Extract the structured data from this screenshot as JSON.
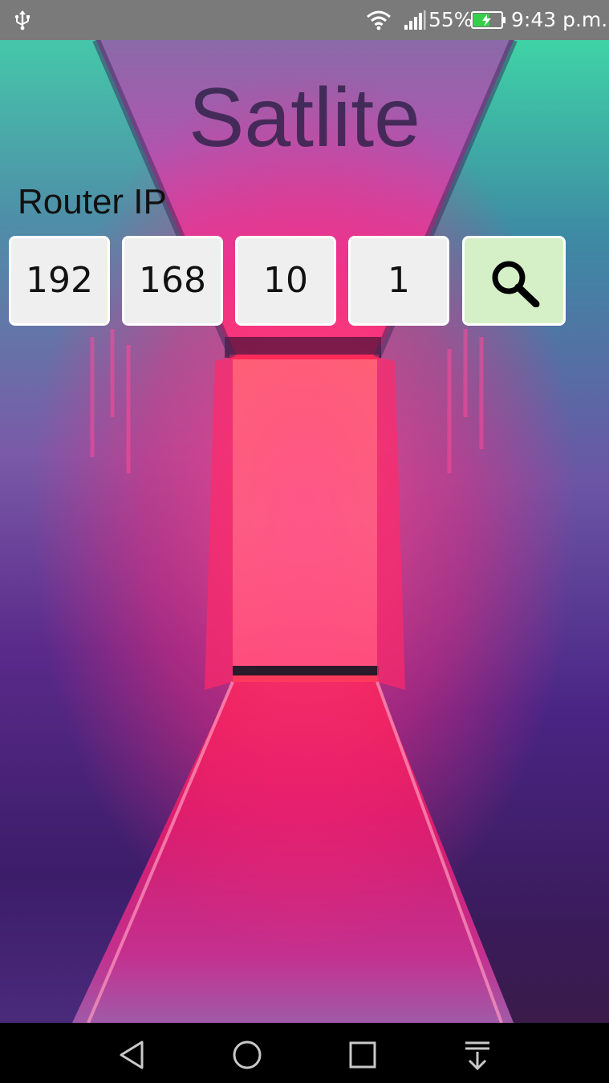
{
  "status_bar": {
    "battery_percent": "55%",
    "time": "9:43 p.m.",
    "icons": [
      "usb-icon",
      "wifi-icon",
      "signal-icon",
      "battery-charging-icon"
    ]
  },
  "app": {
    "title": "Satlite",
    "router_label": "Router IP",
    "ip_octets": [
      "192",
      "168",
      "10",
      "1"
    ],
    "search_button_icon": "search-icon"
  },
  "nav_bar": {
    "buttons": [
      "back-icon",
      "home-icon",
      "recent-apps-icon",
      "notifications-icon"
    ]
  },
  "colors": {
    "status_bar_bg": "#7a7a7a",
    "octet_bg": "#efefef",
    "search_button_bg": "#d5efc7",
    "title_color": "#2e2148",
    "nav_bar_bg": "#000000"
  }
}
